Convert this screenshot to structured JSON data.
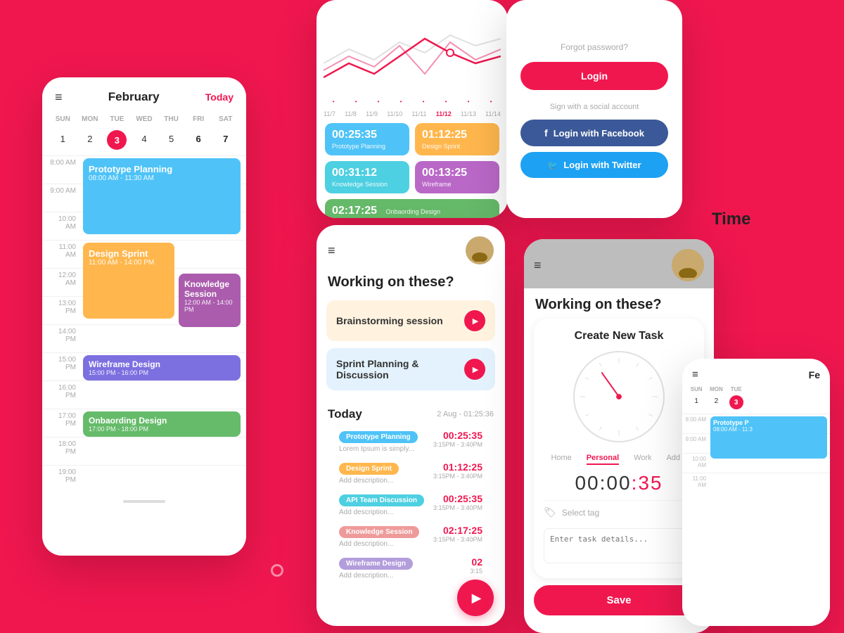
{
  "bg_color": "#f0174f",
  "card_calendar": {
    "title": "February",
    "today_btn": "Today",
    "days": [
      "SUN",
      "MON",
      "TUE",
      "WED",
      "THU",
      "FRI",
      "SAT"
    ],
    "dates": [
      {
        "num": "1",
        "active": false,
        "bold": false
      },
      {
        "num": "2",
        "active": false,
        "bold": false
      },
      {
        "num": "3",
        "active": true,
        "bold": false
      },
      {
        "num": "4",
        "active": false,
        "bold": false
      },
      {
        "num": "5",
        "active": false,
        "bold": false
      },
      {
        "num": "6",
        "active": false,
        "bold": true
      },
      {
        "num": "7",
        "active": false,
        "bold": true
      }
    ],
    "times": [
      "8:00 AM",
      "9:00 AM",
      "10:00 AM",
      "11:00 AM",
      "12:00 AM",
      "13:00 PM",
      "14:00 PM",
      "15:00 PM",
      "16:00 PM",
      "17:00 PM",
      "18:00 PM",
      "19:00 PM"
    ],
    "events": [
      {
        "time_label": "8:00 AM",
        "title": "Prototype Planning",
        "sub": "08:00 AM - 11:30 AM",
        "color": "#4fc3f7",
        "top": "8",
        "height": "100"
      },
      {
        "time_label": "11:00 AM",
        "title": "Design Sprint",
        "sub": "11:00 AM - 14:00 PM",
        "color": "#ffb74d",
        "top": "144",
        "height": "108"
      },
      {
        "time_label": "12:00 AM",
        "title": "Knowledge Session",
        "sub": "12:00 AM - 14:00 PM",
        "color": "#ab5cad",
        "top": "180",
        "height": "80"
      },
      {
        "time_label": "15:00 PM",
        "title": "Wireframe Design",
        "sub": "15:00 PM - 16:00 PM",
        "color": "#7c6fe0",
        "top": "252",
        "height": "36"
      },
      {
        "time_label": "17:00 PM",
        "title": "Onbaording Design",
        "sub": "17:00 PM - 18:00 PM",
        "color": "#66bb6a",
        "top": "324",
        "height": "36"
      }
    ]
  },
  "card_time_top": {
    "chart_dates": [
      "11/7",
      "11/8",
      "11/9",
      "11/10",
      "11/11",
      "11/12",
      "11/13",
      "11/14"
    ],
    "active_date": "11/12",
    "blocks": [
      {
        "time": "00:25:35",
        "label": "Prototype Planning",
        "color": "#4fc3f7"
      },
      {
        "time": "01:12:25",
        "label": "Design Sprint",
        "color": "#ffb74d"
      },
      {
        "time": "00:31:12",
        "label": "Knowledge Session",
        "color": "#4dd0e1"
      },
      {
        "time": "00:13:25",
        "label": "Wireframe",
        "color": "#ba68c8"
      },
      {
        "time": "02:17:25",
        "label": "Onbaording Design",
        "color": "#66bb6a",
        "wide": true
      }
    ]
  },
  "card_login": {
    "forgot_password": "Forgot password?",
    "login_btn": "Login",
    "social_label": "Sign with a social account",
    "facebook_btn": "Login with Facebook",
    "twitter_btn": "Login with Twitter"
  },
  "card_working": {
    "title": "Working on these?",
    "tasks": [
      {
        "label": "Brainstorming session",
        "bg": "#fff3e0"
      },
      {
        "label": "Sprint Planning & Discussion",
        "bg": "#e3f2fd"
      }
    ],
    "today_label": "Today",
    "today_date": "2 Aug - 01:25:36",
    "today_items": [
      {
        "tag": "Prototype Planning",
        "tag_color": "#4fc3f7",
        "tag_text_color": "#fff",
        "desc": "Lorem Ipsum is simply...",
        "time": "00:25:35",
        "sub_time": "3:15PM - 3:40PM"
      },
      {
        "tag": "Design Sprint",
        "tag_color": "#ffb74d",
        "tag_text_color": "#fff",
        "desc": "Add description...",
        "time": "01:12:25",
        "sub_time": "3:15PM - 3:40PM"
      },
      {
        "tag": "API Team Discussion",
        "tag_color": "#4dd0e1",
        "tag_text_color": "#fff",
        "desc": "Add description...",
        "time": "00:25:35",
        "sub_time": "3:15PM - 3:40PM"
      },
      {
        "tag": "Knowledge Session",
        "tag_color": "#ef9a9a",
        "tag_text_color": "#fff",
        "desc": "Add description...",
        "time": "02:17:25",
        "sub_time": "3:15PM - 3:40PM"
      },
      {
        "tag": "Wireframe Design",
        "tag_color": "#b39ddb",
        "tag_text_color": "#fff",
        "desc": "Add description...",
        "time": "02",
        "sub_time": "3:15"
      }
    ]
  },
  "card_create_task": {
    "working_title": "Working on these?",
    "form_title": "Create  New Task",
    "tabs": [
      "Home",
      "Personal",
      "Work",
      "Add +"
    ],
    "active_tab": "Personal",
    "timer": "00:00:35",
    "select_tag": "Select tag",
    "enter_details": "Enter task details...",
    "save_btn": "Save"
  },
  "card_time_right": {
    "label": "Time Trackin"
  },
  "card_cal_small": {
    "title": "Fe",
    "days": [
      "SUN",
      "MON",
      "TUE"
    ],
    "dates": [
      {
        "num": "1",
        "active": false,
        "bold": false
      },
      {
        "num": "2",
        "active": false,
        "bold": false
      },
      {
        "num": "3",
        "active": true,
        "bold": false
      }
    ],
    "times": [
      "8:00 AM",
      "9:00 AM",
      "10:00 AM",
      "11:00 AM"
    ],
    "event": {
      "title": "Prototype P",
      "sub": "08:00 AM - 11:3",
      "color": "#4fc3f7",
      "top": "36",
      "height": "60"
    }
  }
}
